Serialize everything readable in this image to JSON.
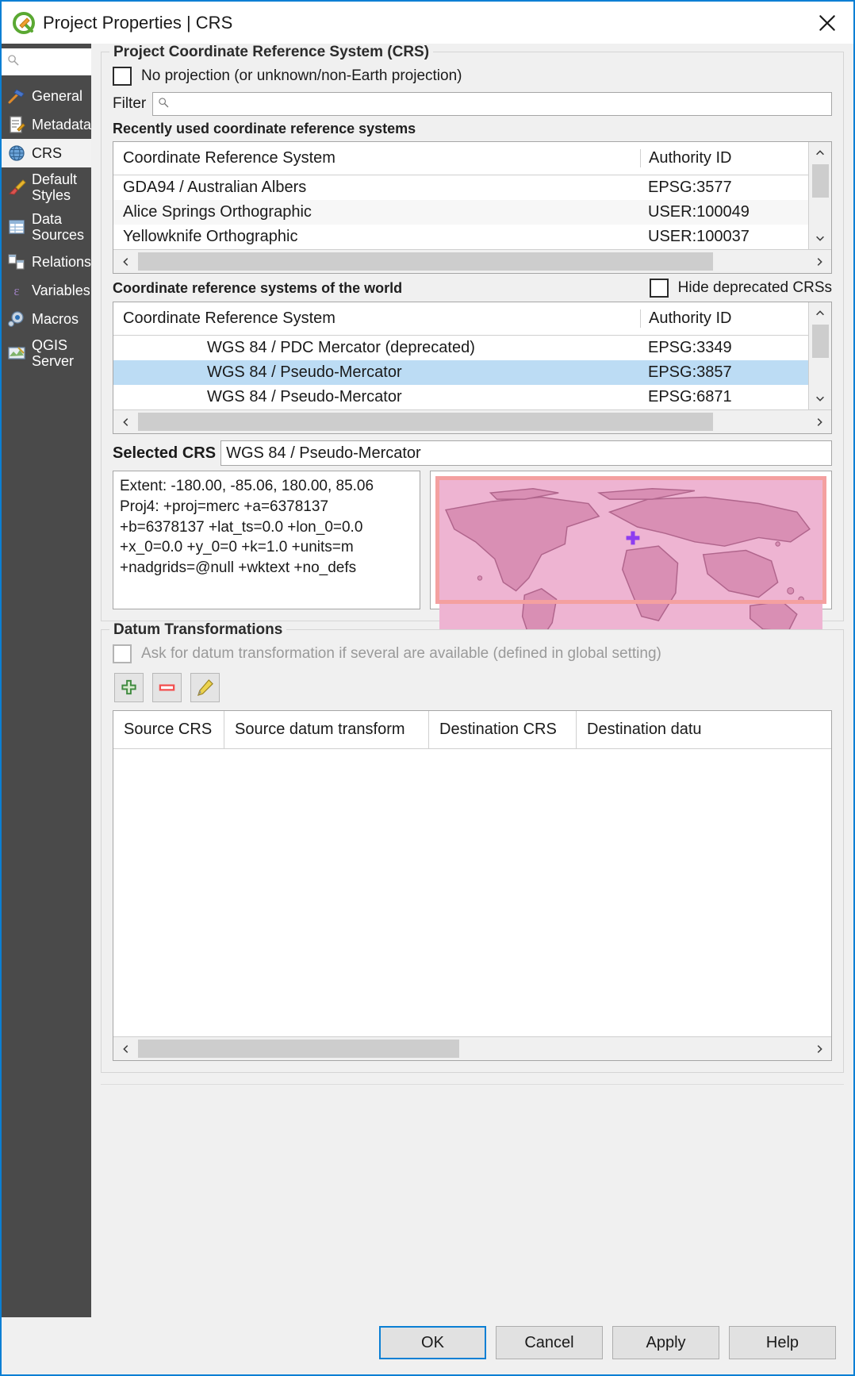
{
  "window": {
    "title": "Project Properties | CRS",
    "logo_icon": "qgis-logo-icon",
    "close_icon": "close-icon"
  },
  "sidebar": {
    "search_placeholder": "",
    "search_icon": "search-icon",
    "items": [
      {
        "label": "General",
        "icon": "hammer-icon",
        "active": false
      },
      {
        "label": "Metadata",
        "icon": "document-pen-icon",
        "active": false
      },
      {
        "label": "CRS",
        "icon": "globe-icon",
        "active": true
      },
      {
        "label": "Default Styles",
        "icon": "paintbrush-icon",
        "active": false
      },
      {
        "label": "Data Sources",
        "icon": "table-icon",
        "active": false
      },
      {
        "label": "Relations",
        "icon": "relations-icon",
        "active": false
      },
      {
        "label": "Variables",
        "icon": "epsilon-icon",
        "active": false
      },
      {
        "label": "Macros",
        "icon": "gear-play-icon",
        "active": false
      },
      {
        "label": "QGIS Server",
        "icon": "server-map-icon",
        "active": false
      }
    ]
  },
  "crs_group": {
    "title": "Project Coordinate Reference System (CRS)",
    "no_projection": {
      "label": "No projection (or unknown/non-Earth projection)",
      "checked": false
    },
    "filter": {
      "label": "Filter",
      "value": "",
      "placeholder": "",
      "icon": "search-icon"
    },
    "recent": {
      "heading": "Recently used coordinate reference systems",
      "columns": [
        "Coordinate Reference System",
        "Authority ID"
      ],
      "rows": [
        {
          "name": "GDA94 / Australian Albers",
          "authority": "EPSG:3577",
          "selected": false
        },
        {
          "name": "Alice Springs Orthographic",
          "authority": "USER:100049",
          "selected": false
        },
        {
          "name": "Yellowknife Orthographic",
          "authority": "USER:100037",
          "selected": false
        }
      ]
    },
    "world": {
      "heading": "Coordinate reference systems of the world",
      "hide_deprecated": {
        "label": "Hide deprecated CRSs",
        "checked": false
      },
      "columns": [
        "Coordinate Reference System",
        "Authority ID"
      ],
      "rows": [
        {
          "name": "WGS 84 / PDC Mercator (deprecated)",
          "authority": "EPSG:3349",
          "selected": false
        },
        {
          "name": "WGS 84 / Pseudo-Mercator",
          "authority": "EPSG:3857",
          "selected": true
        },
        {
          "name": "WGS 84 / Pseudo-Mercator",
          "authority": "EPSG:6871",
          "selected": false
        }
      ]
    },
    "selected_crs": {
      "label": "Selected CRS",
      "value": "WGS 84 / Pseudo-Mercator"
    },
    "proj_info": "Extent: -180.00, -85.06, 180.00, 85.06\nProj4: +proj=merc +a=6378137\n+b=6378137 +lat_ts=0.0 +lon_0=0.0\n+x_0=0.0 +y_0=0 +k=1.0 +units=m\n+nadgrids=@null +wktext +no_defs",
    "map_preview": {
      "land_color": "#d98fb4",
      "water_color": "#eeb4d2",
      "extent_color": "#f4a0a0",
      "marker_color": "#8d3df0",
      "marker_icon": "crosshair-marker-icon"
    }
  },
  "datum_group": {
    "title": "Datum Transformations",
    "ask_checkbox": {
      "label": "Ask for datum transformation if several are available (defined in global setting)",
      "checked": false,
      "enabled": false
    },
    "toolbar": [
      {
        "name": "add-datum-transform-button",
        "icon": "plus-icon"
      },
      {
        "name": "remove-datum-transform-button",
        "icon": "minus-icon"
      },
      {
        "name": "edit-datum-transform-button",
        "icon": "pencil-icon"
      }
    ],
    "table": {
      "columns": [
        "Source CRS",
        "Source datum transform",
        "Destination CRS",
        "Destination datu"
      ],
      "rows": []
    }
  },
  "buttons": [
    {
      "label": "OK",
      "default": true
    },
    {
      "label": "Cancel",
      "default": false
    },
    {
      "label": "Apply",
      "default": false
    },
    {
      "label": "Help",
      "default": false
    }
  ]
}
